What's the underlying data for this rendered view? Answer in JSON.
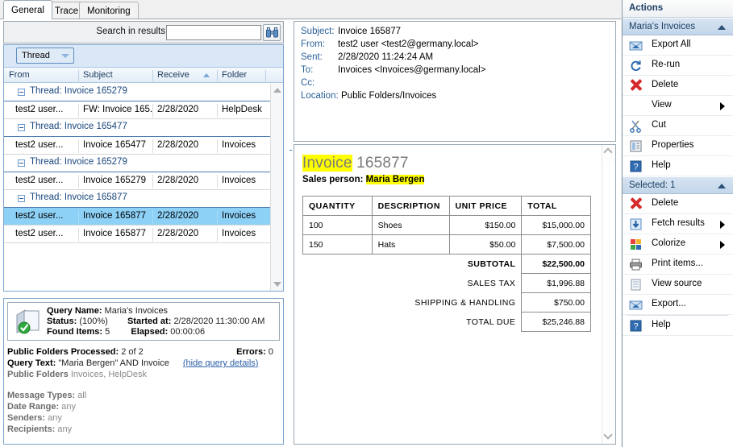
{
  "tabs": [
    {
      "label": "General",
      "active": true
    },
    {
      "label": "Trace",
      "active": false
    },
    {
      "label": "Monitoring",
      "active": false
    }
  ],
  "search": {
    "label": "Search in results",
    "value": "",
    "placeholder": "",
    "button_icon": "binoculars-icon"
  },
  "grid": {
    "group_button": "Thread",
    "columns": [
      "From",
      "Subject",
      "Receive",
      "Folder"
    ],
    "sorted_column": "Receive",
    "sort_direction": "asc",
    "rows": [
      {
        "type": "group",
        "label": "Thread: Invoice 165279"
      },
      {
        "type": "item",
        "from": "test2 user...",
        "subject": "FW: Invoice 165...",
        "receive": "2/28/2020",
        "folder": "HelpDesk",
        "selected": false
      },
      {
        "type": "group",
        "label": "Thread: Invoice 165477"
      },
      {
        "type": "item",
        "from": "test2 user...",
        "subject": "Invoice 165477",
        "receive": "2/28/2020",
        "folder": "Invoices",
        "selected": false
      },
      {
        "type": "group",
        "label": "Thread: Invoice 165279"
      },
      {
        "type": "item",
        "from": "test2 user...",
        "subject": "Invoice 165279",
        "receive": "2/28/2020",
        "folder": "Invoices",
        "selected": false
      },
      {
        "type": "group",
        "label": "Thread: Invoice 165877"
      },
      {
        "type": "item",
        "from": "test2 user...",
        "subject": "Invoice 165877",
        "receive": "2/28/2020",
        "folder": "Invoices",
        "selected": true
      },
      {
        "type": "item",
        "from": "test2 user...",
        "subject": "Invoice 165877",
        "receive": "2/28/2020",
        "folder": "Invoices",
        "selected": false
      }
    ]
  },
  "query": {
    "name_label": "Query Name",
    "name_value": "Maria's Invoices",
    "status_label": "Status",
    "status_value": "(100%)",
    "started_label": "Started at",
    "started_value": "2/28/2020 11:30:00 AM",
    "found_label": "Found Items",
    "found_value": "5",
    "elapsed_label": "Elapsed",
    "elapsed_value": "00:00:06",
    "processed_label": "Public Folders Processed",
    "processed_value": "2 of 2",
    "errors_label": "Errors",
    "errors_value": "0",
    "text_label": "Query Text",
    "text_value": "\"Maria Bergen\" AND Invoice",
    "hide_link": "(hide query details)",
    "folders_label": "Public Folders",
    "folders_value": "Invoices, HelpDesk",
    "msgtypes_label": "Message Types",
    "msgtypes_value": "all",
    "daterange_label": "Date Range",
    "daterange_value": "any",
    "senders_label": "Senders",
    "senders_value": "any",
    "recipients_label": "Recipients",
    "recipients_value": "any"
  },
  "message": {
    "fields": [
      {
        "label": "Subject:",
        "value": "Invoice 165877"
      },
      {
        "label": "From:",
        "value": "test2 user <test2@germany.local>"
      },
      {
        "label": "Sent:",
        "value": "2/28/2020 11:24:24 AM"
      },
      {
        "label": "To:",
        "value": "Invoices <Invoices@germany.local>"
      },
      {
        "label": "Cc:",
        "value": ""
      },
      {
        "label": "Location:",
        "value": "Public Folders/Invoices"
      }
    ]
  },
  "invoice": {
    "title_word": "Invoice",
    "title_number": "165877",
    "sales_label": "Sales person:",
    "sales_name": "Maria Bergen",
    "highlight_color": "#ffff00",
    "columns": [
      "QUANTITY",
      "DESCRIPTION",
      "UNIT PRICE",
      "TOTAL"
    ],
    "line_items": [
      {
        "quantity": "100",
        "description": "Shoes",
        "unit_price": "$150.00",
        "total": "$15,000.00"
      },
      {
        "quantity": "150",
        "description": "Hats",
        "unit_price": "$50.00",
        "total": "$7,500.00"
      }
    ],
    "summary": [
      {
        "label": "SUBTOTAL",
        "value": "$22,500.00",
        "bold": true
      },
      {
        "label": "SALES TAX",
        "value": "$1,996.88",
        "bold": false
      },
      {
        "label": "SHIPPING & HANDLING",
        "value": "$750.00",
        "bold": false
      },
      {
        "label": "TOTAL DUE",
        "value": "$25,246.88",
        "bold": false
      }
    ]
  },
  "actions": {
    "title": "Actions",
    "section_one": {
      "header": "Maria's Invoices",
      "items": [
        {
          "label": "Export All",
          "icon": "export-envelope-icon",
          "submenu": false
        },
        {
          "label": "Re-run",
          "icon": "refresh-icon",
          "submenu": false
        },
        {
          "label": "Delete",
          "icon": "red-x-icon",
          "submenu": false
        },
        {
          "label": "View",
          "icon": "none",
          "submenu": true
        },
        {
          "label": "Cut",
          "icon": "scissors-icon",
          "submenu": false
        },
        {
          "label": "Properties",
          "icon": "properties-icon",
          "submenu": false
        },
        {
          "label": "Help",
          "icon": "help-icon",
          "submenu": false
        }
      ]
    },
    "section_two": {
      "header": "Selected: 1",
      "items": [
        {
          "label": "Delete",
          "icon": "red-x-icon",
          "submenu": false
        },
        {
          "label": "Fetch results",
          "icon": "download-icon",
          "submenu": true
        },
        {
          "label": "Colorize",
          "icon": "colorize-icon",
          "submenu": true
        },
        {
          "label": "Print items...",
          "icon": "printer-icon",
          "submenu": false
        },
        {
          "label": "View source",
          "icon": "notepad-icon",
          "submenu": false
        },
        {
          "label": "Export...",
          "icon": "export-envelope-icon",
          "submenu": false
        },
        {
          "label": "Help",
          "icon": "help-icon",
          "submenu": false
        }
      ]
    }
  }
}
